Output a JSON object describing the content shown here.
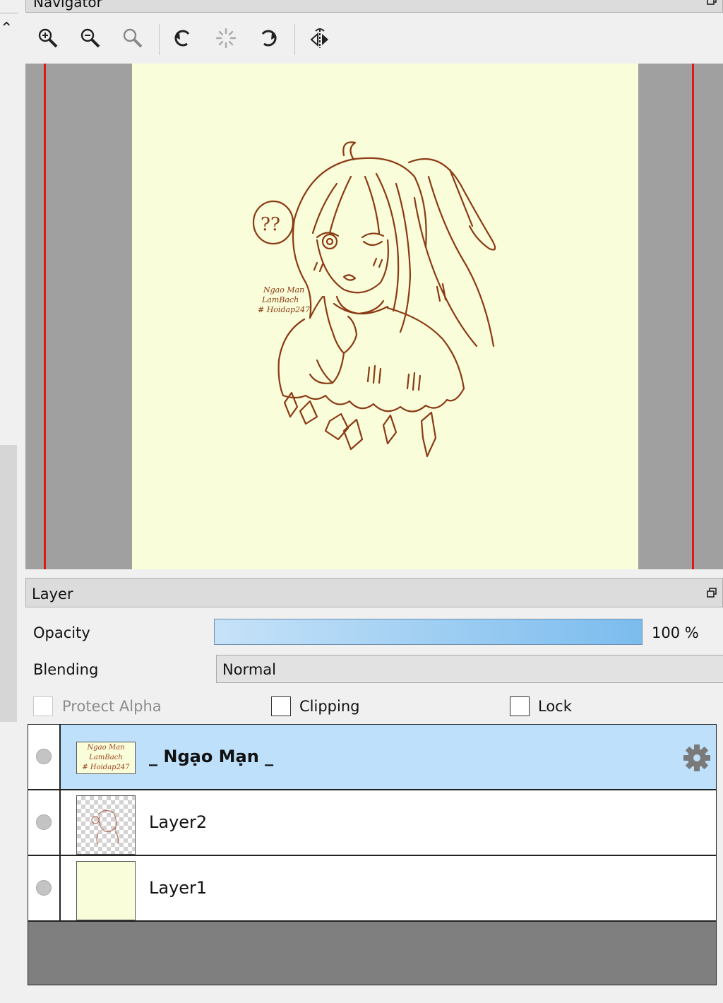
{
  "navigator": {
    "title": "Navigator",
    "toolbar": [
      {
        "name": "zoom-in-icon"
      },
      {
        "name": "zoom-out-icon"
      },
      {
        "name": "zoom-reset-icon"
      },
      {
        "name": "rotate-left-icon"
      },
      {
        "name": "rotate-reset-icon"
      },
      {
        "name": "rotate-right-icon"
      },
      {
        "name": "flip-horizontal-icon"
      }
    ],
    "canvas_text": [
      "Ngao Man",
      "LamBach",
      "# Hoidap247"
    ]
  },
  "layer_panel": {
    "title": "Layer",
    "opacity_label": "Opacity",
    "opacity_value": "100 %",
    "opacity_fraction": 1.0,
    "blending_label": "Blending",
    "blending_value": "Normal",
    "protect_alpha_label": "Protect Alpha",
    "clipping_label": "Clipping",
    "lock_label": "Lock",
    "protect_alpha_checked": false,
    "clipping_checked": false,
    "lock_checked": false,
    "layers": [
      {
        "name": "_ Ngạo Mạn _",
        "selected": true,
        "thumb_text": [
          "Ngao Man",
          "LamBach",
          "# Hoidap247"
        ]
      },
      {
        "name": "Layer2",
        "selected": false
      },
      {
        "name": "Layer1",
        "selected": false
      }
    ]
  },
  "colors": {
    "canvas": "#f9fdd9",
    "line_art": "#8a3a14",
    "selection": "#bee0fa",
    "guide_line": "#e01818"
  }
}
